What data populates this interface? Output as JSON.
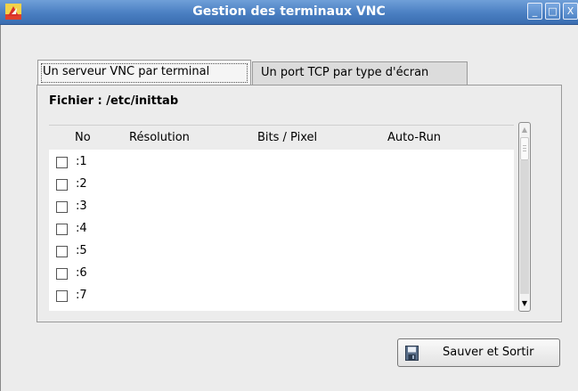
{
  "window": {
    "title": "Gestion des terminaux VNC",
    "controls": [
      "_",
      "□",
      "X"
    ]
  },
  "tabs": [
    {
      "label": "Un serveur VNC par terminal",
      "active": true
    },
    {
      "label": "Un port TCP par type d'écran",
      "active": false
    }
  ],
  "file_label": "Fichier : /etc/inittab",
  "table": {
    "headers": [
      "No",
      "Résolution",
      "Bits / Pixel",
      "Auto-Run"
    ],
    "rows": [
      {
        "no": ":1",
        "checked": false
      },
      {
        "no": ":2",
        "checked": false
      },
      {
        "no": ":3",
        "checked": false
      },
      {
        "no": ":4",
        "checked": false
      },
      {
        "no": ":5",
        "checked": false
      },
      {
        "no": ":6",
        "checked": false
      },
      {
        "no": ":7",
        "checked": false
      }
    ]
  },
  "buttons": {
    "save_exit": "Sauver et Sortir"
  },
  "icons": {
    "app": "app-logo-icon",
    "save": "floppy-disk-icon"
  },
  "colors": {
    "titlebar": "#4a7fc2",
    "background": "#ececec"
  }
}
